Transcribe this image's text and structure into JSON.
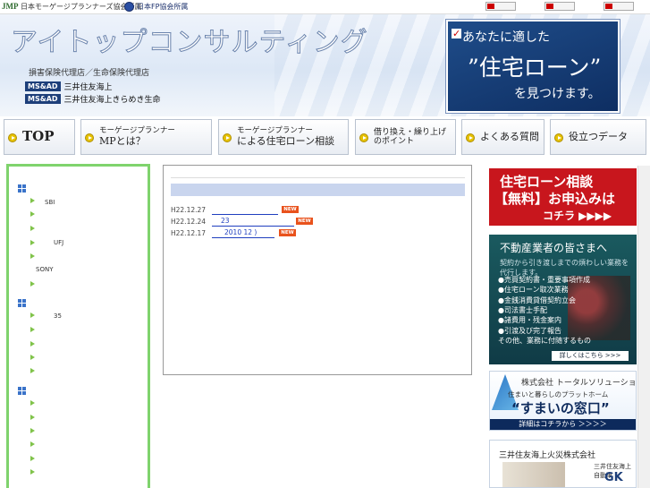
{
  "topbar": {
    "jmp_logo": "JMP",
    "jmp_text": "日本モーゲージプランナーズ協会所属",
    "fpa_text": "日本FP協会所属"
  },
  "header": {
    "brand": "アイトップコンサルティング",
    "agency": "損害保険代理店／生命保険代理店",
    "ins1_tag": "MS&AD",
    "ins1_name": "三井住友海上",
    "ins2_tag": "MS&AD",
    "ins2_name": "三井住友海上きらめき生命"
  },
  "hero": {
    "line1": "あなたに適した",
    "line2": "”住宅ローン”",
    "line3": "を見つけます。"
  },
  "nav": {
    "top": "TOP",
    "mp_small": "モーゲージプランナー",
    "mp_mid": "MPとは？",
    "loan_small": "モーゲージプランナー",
    "loan_mid": "による住宅ローン相談",
    "refi_line1": "借り換え・繰り上げ",
    "refi_line2": "のポイント",
    "faq": "よくある質問",
    "data": "役立つデータ"
  },
  "sidebar": {
    "t1": "SBI",
    "t2": "UFJ",
    "t3": "SONY",
    "t4": "35"
  },
  "news": [
    {
      "date": "H22.12.27",
      "title": "",
      "badge": "NEW"
    },
    {
      "date": "H22.12.24",
      "title": "23",
      "badge": "NEW"
    },
    {
      "date": "H22.12.17",
      "title": "2010 12 )",
      "badge": "NEW"
    }
  ],
  "banners": {
    "consult_l1": "住宅ローン相談",
    "consult_l2": "【無料】お申込みは",
    "consult_l3": "コチラ ▶▶▶▶",
    "realtor_title": "不動産業者の皆さまへ",
    "realtor_sub": "契約から引き渡しまでの煩わしい業務を代行します。",
    "realtor_items": [
      "●売買契約書・重要事項作成",
      "●住宅ローン取次業務",
      "●金銭消費貸借契約立会",
      "●司法書士手配",
      "●諸費用・残金案内",
      "●引渡及び完了報告",
      "その他、業務に付随するもの"
    ],
    "realtor_more": "詳しくはこちら >>>",
    "total_co": "株式会社 トータルソリューション",
    "total_tag": "住まいと暮らしのプラットホーム",
    "total_big": "“すまいの窓口”",
    "total_cta": "詳細はコチラから ＞＞＞＞",
    "ms_co": "三井住友海上火災株式会社",
    "gk_small": "三井住友海上自動車",
    "gk_logo": "GK"
  }
}
